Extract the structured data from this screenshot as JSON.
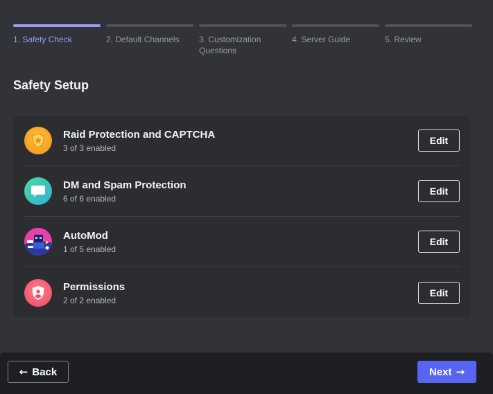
{
  "progress": {
    "steps": [
      {
        "label": "1. Safety Check",
        "active": true
      },
      {
        "label": "2. Default Channels",
        "active": false
      },
      {
        "label": "3. Customization Questions",
        "active": false
      },
      {
        "label": "4. Server Guide",
        "active": false
      },
      {
        "label": "5. Review",
        "active": false
      }
    ]
  },
  "page": {
    "title": "Safety Setup"
  },
  "settings": {
    "items": [
      {
        "name": "Raid Protection and CAPTCHA",
        "status": "3 of 3 enabled",
        "icon": "shield-star-icon",
        "color": "#f9a62b",
        "edit_label": "Edit"
      },
      {
        "name": "DM and Spam Protection",
        "status": "6 of 6 enabled",
        "icon": "chat-bubble-icon",
        "color": "#38c5a5",
        "edit_label": "Edit"
      },
      {
        "name": "AutoMod",
        "status": "1 of 5 enabled",
        "icon": "automod-robot-icon",
        "color": "#3b5bdb",
        "edit_label": "Edit"
      },
      {
        "name": "Permissions",
        "status": "2 of 2 enabled",
        "icon": "shield-user-icon",
        "color": "#f2566f",
        "edit_label": "Edit"
      }
    ]
  },
  "footer": {
    "back_label": "Back",
    "next_label": "Next",
    "accent": "#5865f2"
  }
}
